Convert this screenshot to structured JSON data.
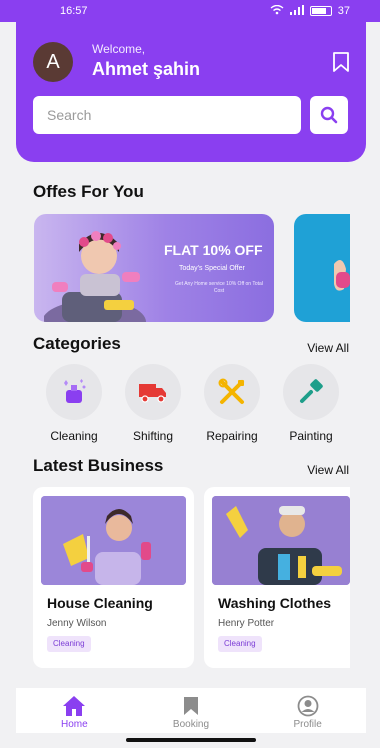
{
  "status_bar": {
    "time": "16:57",
    "battery": "37"
  },
  "header": {
    "avatar_letter": "A",
    "welcome": "Welcome,",
    "user_name": "Ahmet şahin",
    "search_placeholder": "Search"
  },
  "offers": {
    "title": "Offes For You",
    "card": {
      "headline": "FLAT 10% OFF",
      "subtitle": "Today's Special Offer",
      "small_text": "Get Any Home service 10% Off on Total Cost"
    }
  },
  "categories": {
    "title": "Categories",
    "view_all": "View All",
    "items": [
      {
        "label": "Cleaning",
        "icon": "cleaning-icon",
        "color": "#8a3ff0"
      },
      {
        "label": "Shifting",
        "icon": "truck-icon",
        "color": "#e53935"
      },
      {
        "label": "Repairing",
        "icon": "tools-icon",
        "color": "#f4b400"
      },
      {
        "label": "Painting",
        "icon": "paint-brush-icon",
        "color": "#1e9e8a"
      }
    ]
  },
  "latest_business": {
    "title": "Latest Business",
    "view_all": "View All",
    "items": [
      {
        "title": "House Cleaning",
        "person": "Jenny Wilson",
        "tag": "Cleaning"
      },
      {
        "title": "Washing Clothes",
        "person": "Henry Potter",
        "tag": "Cleaning"
      }
    ]
  },
  "nav": {
    "items": [
      {
        "label": "Home",
        "icon": "home-icon",
        "active": true
      },
      {
        "label": "Booking",
        "icon": "bookmark-icon",
        "active": false
      },
      {
        "label": "Profile",
        "icon": "profile-icon",
        "active": false
      }
    ]
  },
  "colors": {
    "primary": "#8a3ff0",
    "background": "#f1f1f3",
    "tag_bg": "#efe3fb"
  }
}
